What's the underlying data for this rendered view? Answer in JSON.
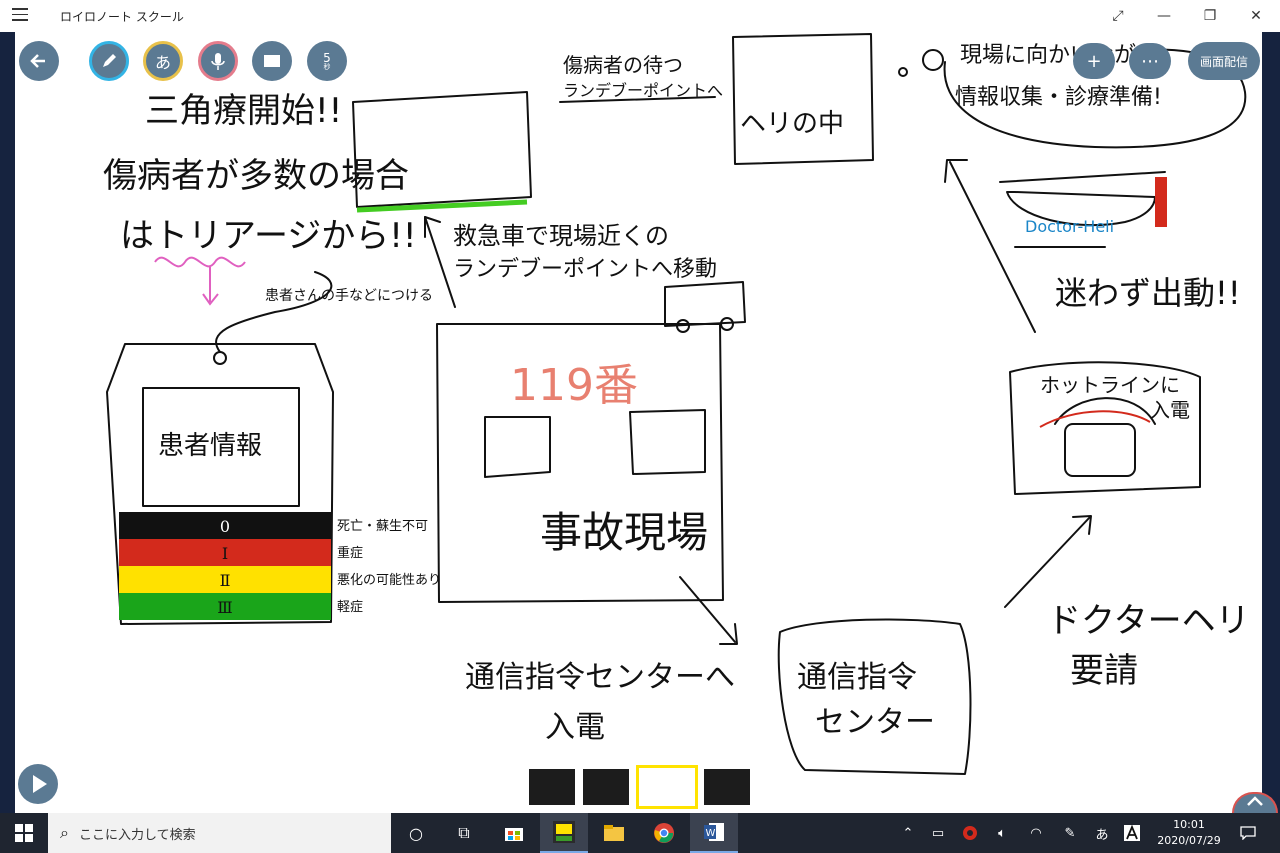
{
  "window": {
    "title": "ロイロノート スクール",
    "minimize": "—",
    "restore": "❐",
    "close": "✕",
    "fullscreen": "⤢"
  },
  "toolbar": {
    "back_icon": "back-arrow-icon",
    "pen_icon": "pen-icon",
    "text_label": "あ",
    "mic_icon": "microphone-icon",
    "card_icon": "card-icon",
    "timer_value": "5",
    "timer_unit": "秒"
  },
  "top_right": {
    "add_label": "+",
    "more_label": "⋯",
    "share_label": "画面配信"
  },
  "drawing": {
    "note1": [
      "三角療開始!!",
      "傷病者が多数の場合",
      "はトリアージから!!"
    ],
    "tag_note": "患者さんの手などにつける",
    "patient_info": "患者情報",
    "triage": [
      {
        "level": "0",
        "desc": "死亡・蘇生不可",
        "color": "#111111"
      },
      {
        "level": "Ⅰ",
        "desc": "重症",
        "color": "#d32a1c"
      },
      {
        "level": "Ⅱ",
        "desc": "悪化の可能性あり",
        "color": "#ffe100"
      },
      {
        "level": "Ⅲ",
        "desc": "軽症",
        "color": "#1aa51a"
      }
    ],
    "note_wait": [
      "傷病者の待つ",
      "ランデブーポイントへ"
    ],
    "heli_box": "ヘリの中",
    "note_move": [
      "救急車で現場近くの",
      "ランデブーポイントへ移動"
    ],
    "phone_119": "119番",
    "accident": "事故現場",
    "to_center": [
      "通信指令センターへ",
      "入電"
    ],
    "center": [
      "通信指令",
      "センター"
    ],
    "request": [
      "ドクターヘリ",
      "要請"
    ],
    "hotline": [
      "ホットラインに",
      "入電"
    ],
    "dispatch": "迷わず出動!!",
    "doctor_heli": "Doctor-Heli",
    "info_note": [
      "現場に向かいながら",
      "情報収集・診療準備!"
    ]
  },
  "taskbar": {
    "search_placeholder": "ここに入力して検索",
    "ime": "あ",
    "time": "10:01",
    "date": "2020/07/29"
  }
}
